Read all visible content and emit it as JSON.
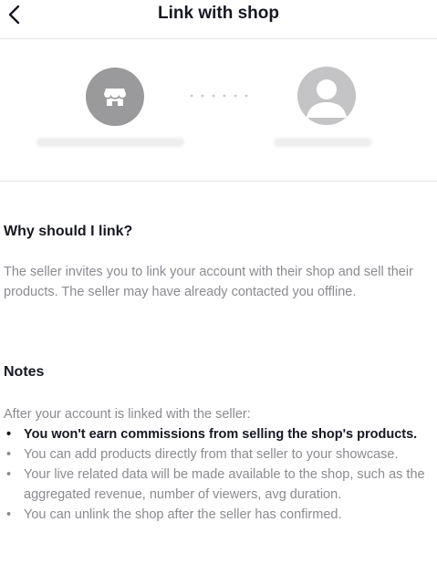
{
  "header": {
    "title": "Link with shop"
  },
  "icons": {
    "back": "chevron-left-icon",
    "shop": "store-icon",
    "user": "user-avatar-icon"
  },
  "why": {
    "title": "Why should I link?",
    "body": "The seller invites you to link your account with their shop and sell their products. The seller may have already contacted you offline."
  },
  "notes": {
    "title": "Notes",
    "intro": "After your account is linked with the seller:",
    "items": [
      {
        "text": "You won't earn commissions from selling the shop's products.",
        "emphasis": true
      },
      {
        "text": "You can add products directly from that seller to your showcase.",
        "emphasis": false
      },
      {
        "text": "Your live related data will be made available to the shop, such as the aggregated revenue, number of viewers, avg duration.",
        "emphasis": false
      },
      {
        "text": "You can unlink the shop after the seller has confirmed.",
        "emphasis": false
      }
    ]
  },
  "colors": {
    "title_text": "#161823",
    "secondary_text": "#8a8b91",
    "shop_circle": "#9a9a9c",
    "user_circle": "#c4c4c6",
    "divider": "#e5e5e5"
  }
}
